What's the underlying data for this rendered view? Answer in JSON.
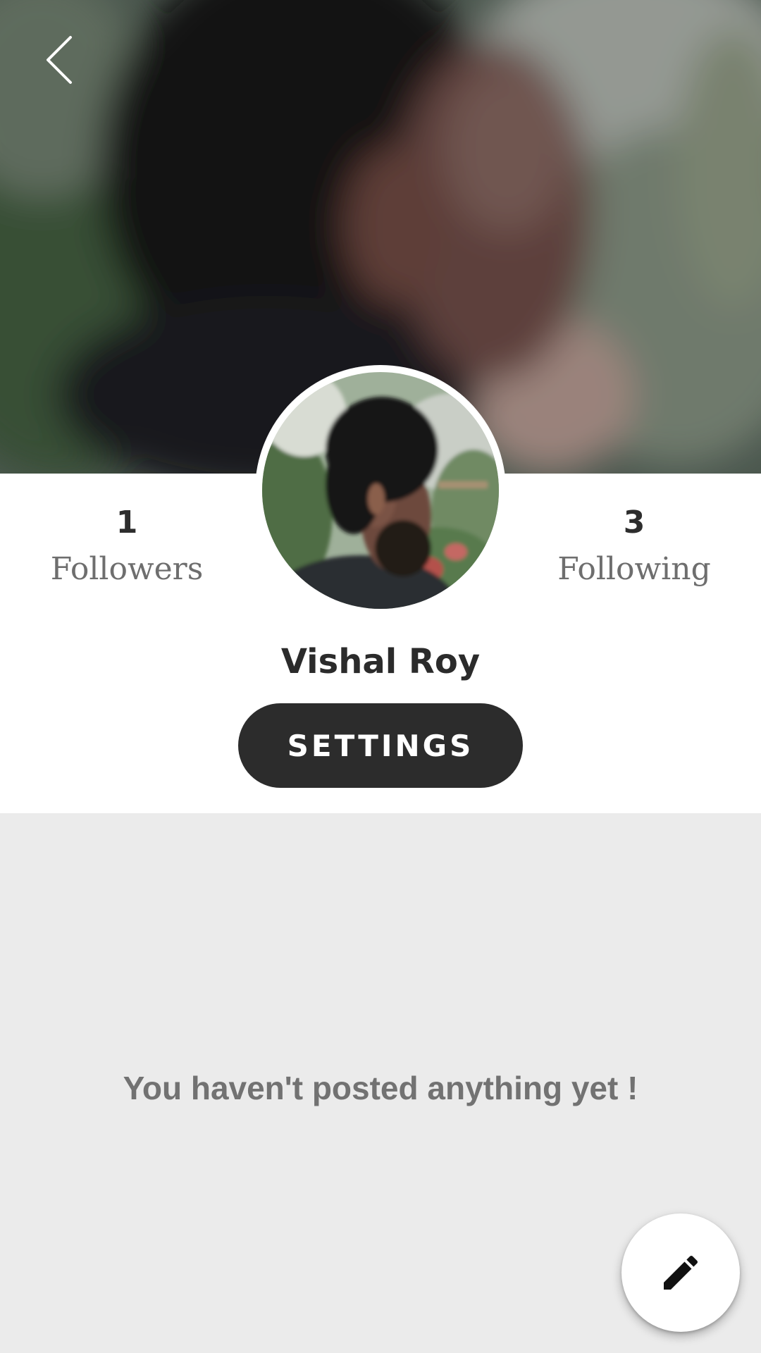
{
  "header": {
    "back_icon": "chevron-left-icon",
    "cover_photo": "blurred profile photo"
  },
  "profile": {
    "followers": {
      "count": "1",
      "label": "Followers"
    },
    "following": {
      "count": "3",
      "label": "Following"
    },
    "name": "Vishal Roy",
    "settings_label": "SETTINGS"
  },
  "posts": {
    "empty_message": "You haven't posted anything yet !"
  },
  "fab": {
    "icon": "pencil-icon"
  },
  "colors": {
    "settings_button_bg": "#2c2c2c",
    "card_bg": "#ffffff",
    "page_bg": "#ebebeb",
    "muted_text": "#727272"
  }
}
